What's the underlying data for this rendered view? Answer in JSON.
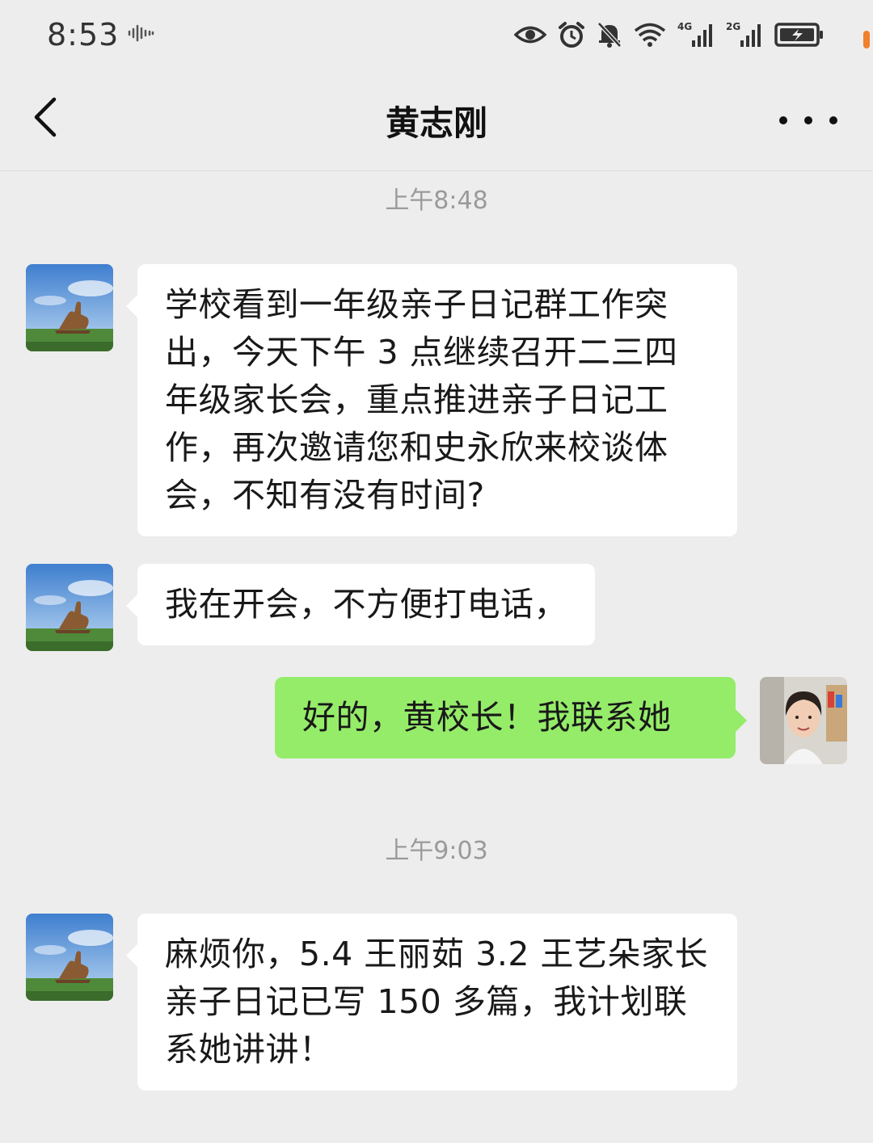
{
  "status_bar": {
    "time": "8:53",
    "icons": [
      "sound-wave-icon",
      "eye-icon",
      "alarm-icon",
      "mute-bell-icon",
      "wifi-icon",
      "signal-4g-icon",
      "signal-2g-icon",
      "battery-charging-icon"
    ],
    "network_1": "4G",
    "network_2": "2G"
  },
  "header": {
    "title": "黄志刚",
    "back_icon": "chevron-left-icon",
    "more_icon": "more-dots-icon"
  },
  "messages": {
    "time_1": "上午8:48",
    "time_2": "上午9:03",
    "m1": "学校看到一年级亲子日记群工作突出，今天下午 3 点继续召开二三四年级家长会，重点推进亲子日记工作，再次邀请您和史永欣来校谈体会，不知有没有时间?",
    "m2": "我在开会，不方便打电话，",
    "m3": "好的，黄校长！我联系她",
    "m4": "麻烦你，5.4 王丽茹 3.2 王艺朵家长亲子日记已写 150 多篇，我计划联系她讲讲！"
  },
  "colors": {
    "background": "#ededed",
    "bubble_incoming": "#ffffff",
    "bubble_outgoing": "#95ec69",
    "timestamp": "#9a9a9a"
  }
}
